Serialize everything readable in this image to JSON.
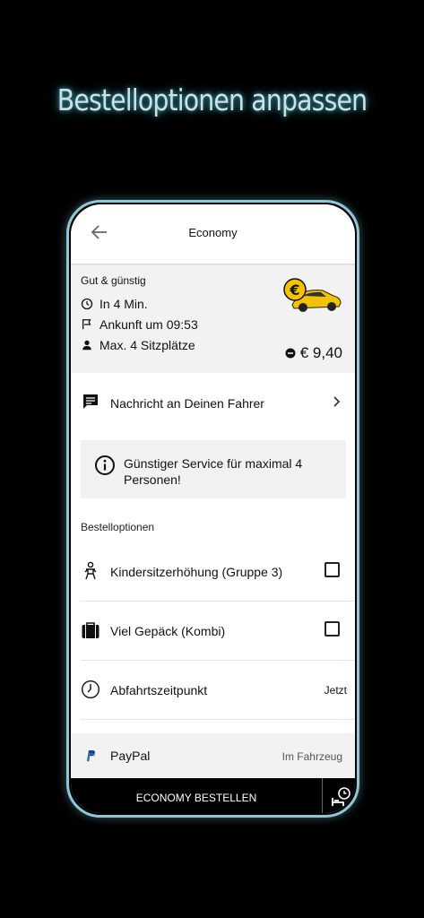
{
  "headline": "Bestelloptionen anpassen",
  "header": {
    "title": "Economy"
  },
  "summary": {
    "subtitle": "Gut & günstig",
    "eta": "In 4 Min.",
    "arrival": "Ankunft um 09:53",
    "seats": "Max. 4 Sitzplätze",
    "price": "€ 9,40"
  },
  "message": {
    "label": "Nachricht an Deinen Fahrer"
  },
  "info": {
    "text": "Günstiger Service für maximal 4 Personen!"
  },
  "options": {
    "section_label": "Bestelloptionen",
    "child_seat": {
      "label": "Kindersitzerhöhung (Gruppe 3)",
      "checked": false
    },
    "luggage": {
      "label": "Viel Gepäck (Kombi)",
      "checked": false
    },
    "departure": {
      "label": "Abfahrtszeitpunkt",
      "value": "Jetzt"
    }
  },
  "payment": {
    "method": "PayPal",
    "value": "Im Fahrzeug"
  },
  "order": {
    "label": "ECONOMY BESTELLEN"
  },
  "colors": {
    "accent_gold": "#f5c200",
    "phone_border": "#8ec7d8",
    "background": "#000000"
  },
  "icons": [
    "back-arrow-icon",
    "clock-icon",
    "flag-icon",
    "person-icon",
    "taxi-car-icon",
    "coin-icon",
    "message-icon",
    "chevron-right-icon",
    "info-icon",
    "child-seat-icon",
    "luggage-icon",
    "clock-icon",
    "paypal-icon",
    "schedule-ride-icon"
  ]
}
